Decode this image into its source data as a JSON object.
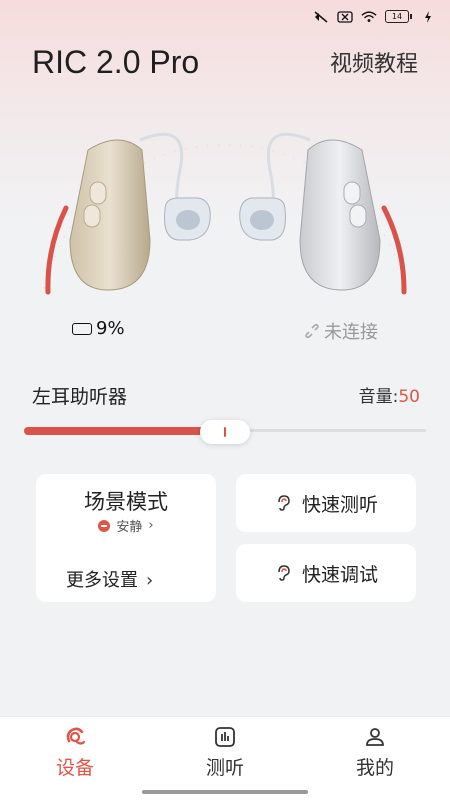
{
  "header": {
    "title": "RIC 2.0 Pro",
    "video_tutorial": "视频教程"
  },
  "status_bar": {
    "battery": "14"
  },
  "devices": {
    "left_battery": "9%",
    "right_status": "未连接"
  },
  "left_aid": {
    "label": "左耳助听器",
    "volume_label": "音量:",
    "volume_value": "50",
    "volume_fraction": 0.5
  },
  "scene": {
    "title": "场景模式",
    "current": "安静",
    "more": "更多设置"
  },
  "actions": {
    "quick_test": "快速测听",
    "quick_tune": "快速调试"
  },
  "tabs": [
    {
      "label": "设备",
      "icon": "device-icon",
      "active": true
    },
    {
      "label": "测听",
      "icon": "hearing-test-icon",
      "active": false
    },
    {
      "label": "我的",
      "icon": "profile-icon",
      "active": false
    }
  ],
  "colors": {
    "accent": "#e05548",
    "active_tab": "#e05548"
  }
}
